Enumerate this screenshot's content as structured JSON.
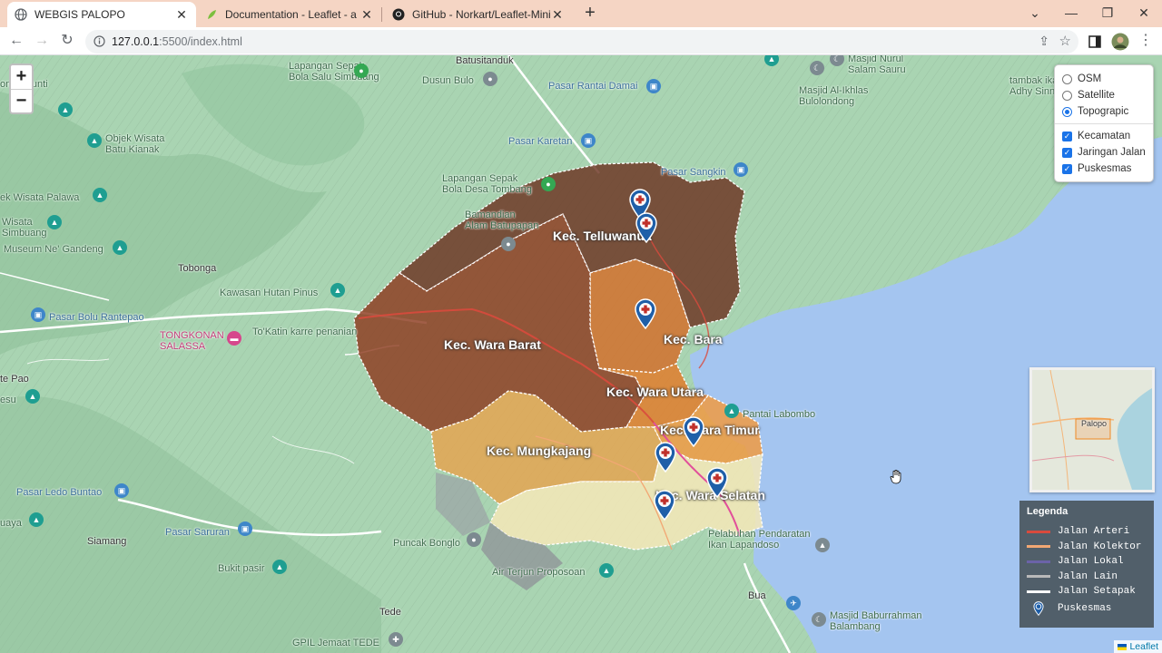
{
  "tabs": [
    {
      "title": "WEBGIS PALOPO",
      "icon": "globe-icon",
      "active": true
    },
    {
      "title": "Documentation - Leaflet - a JavaScript",
      "icon": "leaflet-icon",
      "active": false
    },
    {
      "title": "GitHub - Norkart/Leaflet-MiniMap",
      "icon": "github-icon",
      "active": false
    }
  ],
  "address": {
    "host": "127.0.0.1",
    "path": ":5500/index.html"
  },
  "layers": {
    "base": [
      {
        "label": "OSM",
        "selected": false
      },
      {
        "label": "Satellite",
        "selected": false
      },
      {
        "label": "Topograpic",
        "selected": true
      }
    ],
    "overlays": [
      {
        "label": "Kecamatan",
        "checked": true
      },
      {
        "label": "Jaringan Jalan",
        "checked": true
      },
      {
        "label": "Puskesmas",
        "checked": true
      }
    ]
  },
  "zoom": {
    "in": "+",
    "out": "−"
  },
  "districts": [
    {
      "name": "Kec. Telluwanua",
      "color": "#6b3321"
    },
    {
      "name": "Kec. Wara Barat",
      "color": "#8c3b1f"
    },
    {
      "name": "Kec. Bara",
      "color": "#d2702c"
    },
    {
      "name": "Kec. Wara Utara",
      "color": "#e07d2c"
    },
    {
      "name": "Kec. Wara Timur",
      "color": "#f09a43"
    },
    {
      "name": "Kec. Mungkajang",
      "color": "#e4a451"
    },
    {
      "name": "Kec. Wara Selatan",
      "color": "#f6e7b7"
    }
  ],
  "place_labels": {
    "lapangan_salu": "Lapangan Sepak\nBola Salu Simbuang",
    "batusitanduk": "Batusitanduk",
    "dusun_bulo": "Dusun Bulo",
    "pasar_rantai": "Pasar Rantai Damai",
    "masjid_nurul": "Masjid Nurul\nSalam Sauru",
    "masjid_ikhlas": "Masjid Al-Ikhlas\nBulolondong",
    "tambak": "tambak ikan\nAdhy Sinna",
    "pasar_karetan": "Pasar Karetan",
    "pasar_sangkin": "Pasar Sangkin",
    "lapangan_tombang": "Lapangan Sepak\nBola Desa Tombang",
    "objek_wisata_kianak": "Objek Wisata\nBatu Kianak",
    "wisata_palawa": "ek Wisata Palawa",
    "wisata_simbuang": "Wisata\nSimbuang",
    "museum": "Museum Ne' Gandeng",
    "tobonga": "Tobonga",
    "kawasan_hutan": "Kawasan Hutan Pinus",
    "pasar_bolu": "Pasar Bolu Rantepao",
    "tongkonan": "TONGKONAN\nSALASSA",
    "tokatin": "To'Katin karre penanian",
    "te_pao": "te Pao",
    "esu": "esu",
    "pantai": "Pantai Labombo",
    "pasar_ledo": "Pasar Ledo Buntao",
    "pasar_saruran": "Pasar Saruran",
    "siamang": "Siamang",
    "bukit": "Bukit pasir",
    "puncak": "Puncak Bonglo",
    "air_terjun": "Air Terjun Proposoan",
    "uaya": "uaya",
    "pelabuhan": "Pelabuhan Pendaratan\nIkan Lapandoso",
    "bua": "Bua",
    "masjid_baburrahman": "Masjid Baburrahman\nBalambang",
    "tede": "Tede",
    "gpil": "GPIL Jemaat TEDE",
    "punti": "onan Punti",
    "bamandian": "Bamandian\nAlam Batupapan",
    "minimap_label": "Palopo"
  },
  "legend": {
    "title": "Legenda",
    "items": [
      {
        "label": "Jalan Arteri",
        "color": "#d94a3d"
      },
      {
        "label": "Jalan Kolektor",
        "color": "#f2a774"
      },
      {
        "label": "Jalan Lokal",
        "color": "#6b63a8"
      },
      {
        "label": "Jalan Lain",
        "color": "#b9b9b9"
      },
      {
        "label": "Jalan Setapak",
        "color": "#ffffff"
      }
    ],
    "marker_label": "Puskesmas"
  },
  "attribution": "Leaflet"
}
